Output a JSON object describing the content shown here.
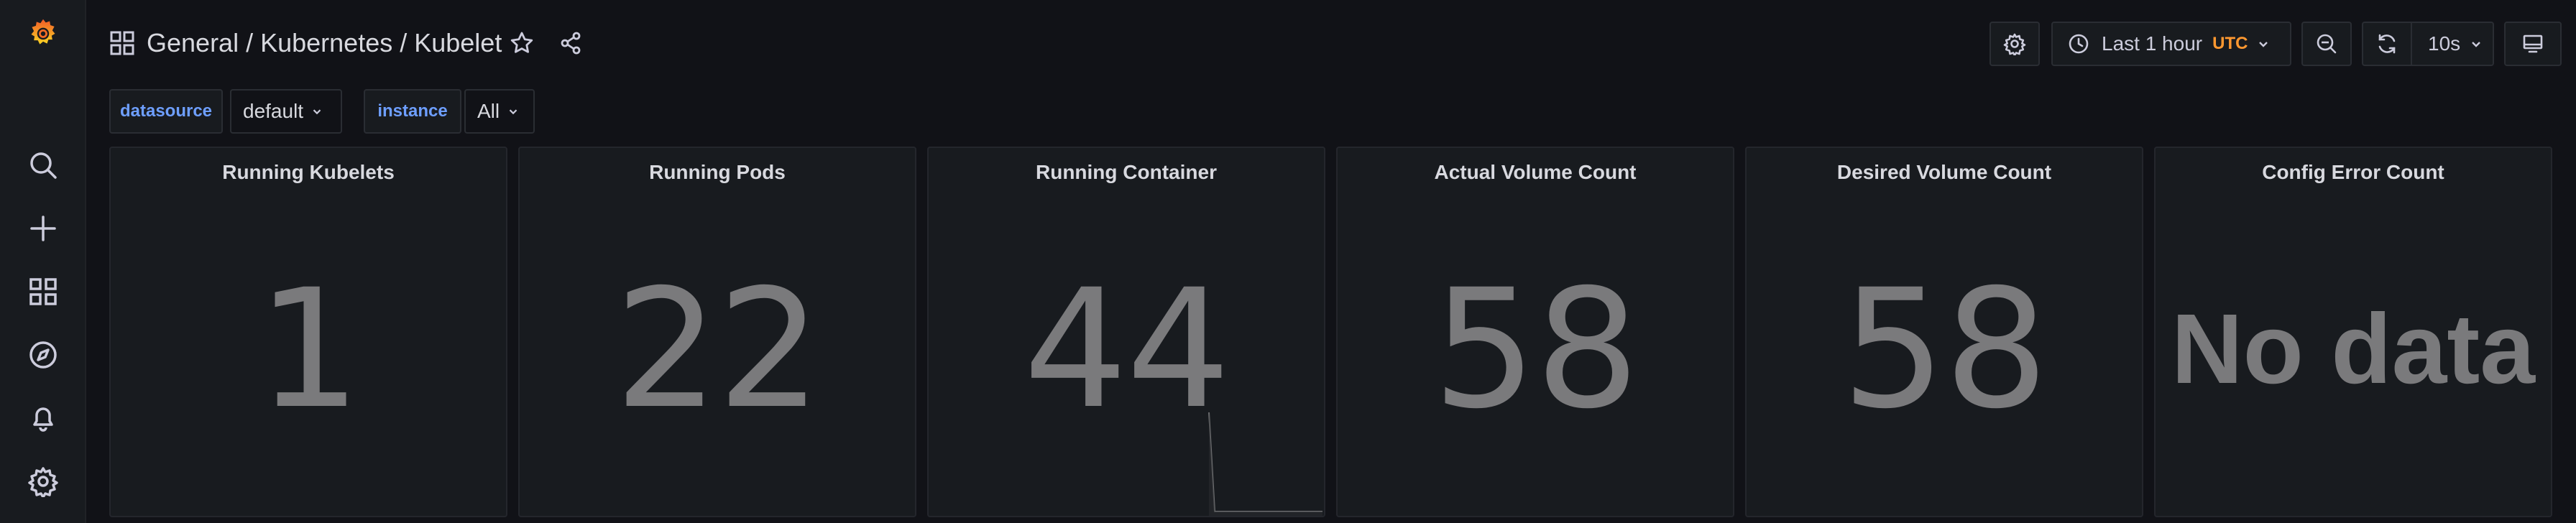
{
  "breadcrumb": {
    "folder": "General",
    "separator": " / ",
    "title": "Kubernetes / Kubelet"
  },
  "toolbar": {
    "time_range": "Last 1 hour",
    "timezone": "UTC",
    "refresh_interval": "10s"
  },
  "variables": [
    {
      "label": "datasource",
      "value": "default"
    },
    {
      "label": "instance",
      "value": "All"
    }
  ],
  "panels": [
    {
      "title": "Running Kubelets",
      "value": "1"
    },
    {
      "title": "Running Pods",
      "value": "22"
    },
    {
      "title": "Running Container",
      "value": "44"
    },
    {
      "title": "Actual Volume Count",
      "value": "58"
    },
    {
      "title": "Desired Volume Count",
      "value": "58"
    },
    {
      "title": "Config Error Count",
      "value": "No data"
    }
  ],
  "colors": {
    "background": "#111217",
    "panel": "#181b1f",
    "variable_label": "#6e9fff",
    "timezone": "#ff9830",
    "stat_value": "#7a7a7c"
  },
  "icons": {
    "sidebar": [
      "grafana-logo",
      "search-icon",
      "plus-icon",
      "dashboards-icon",
      "explore-icon",
      "alerting-icon",
      "settings-icon"
    ],
    "header": [
      "dashboard-grid-icon",
      "star-icon",
      "share-icon",
      "gear-icon",
      "clock-icon",
      "zoom-out-icon",
      "refresh-icon",
      "tv-icon"
    ]
  }
}
